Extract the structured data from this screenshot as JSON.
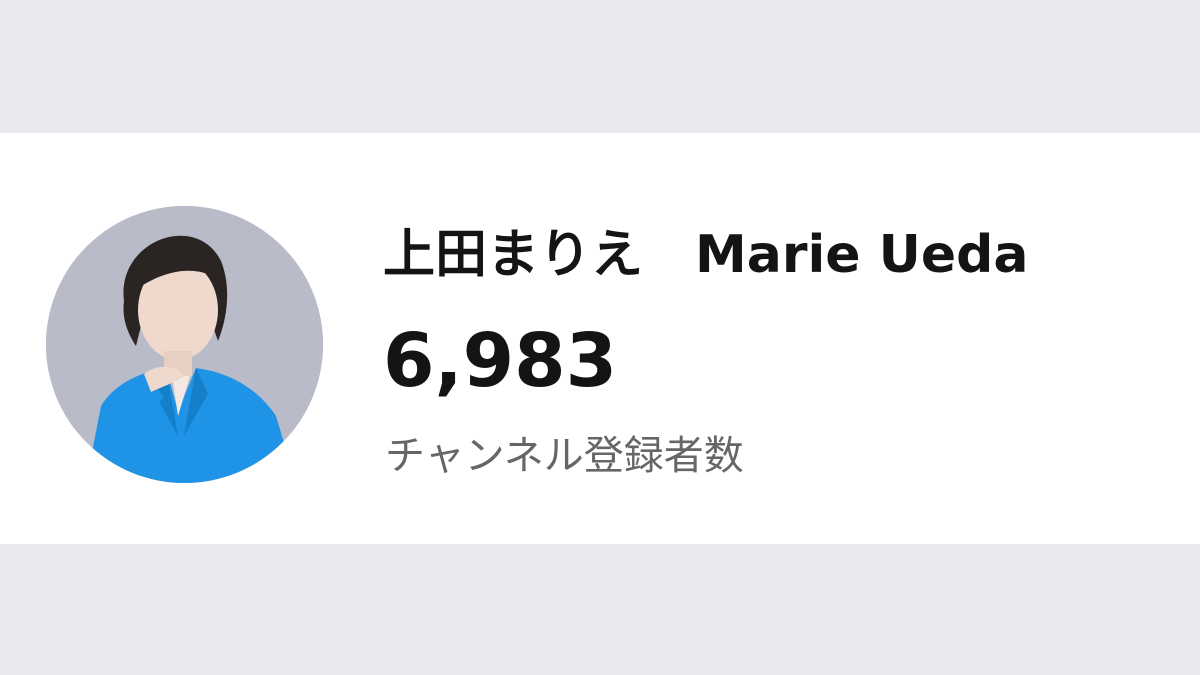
{
  "colors": {
    "page_background": "#e9eaee",
    "card_background": "#ffffff",
    "title_text": "#141414",
    "secondary_text": "#666666",
    "avatar_jacket": "#1f93e6"
  },
  "channel": {
    "name": "上田まりえ　Marie Ueda",
    "subscriber_count": "6,983",
    "subscriber_label": "チャンネル登録者数",
    "avatar_icon": "profile-photo"
  }
}
